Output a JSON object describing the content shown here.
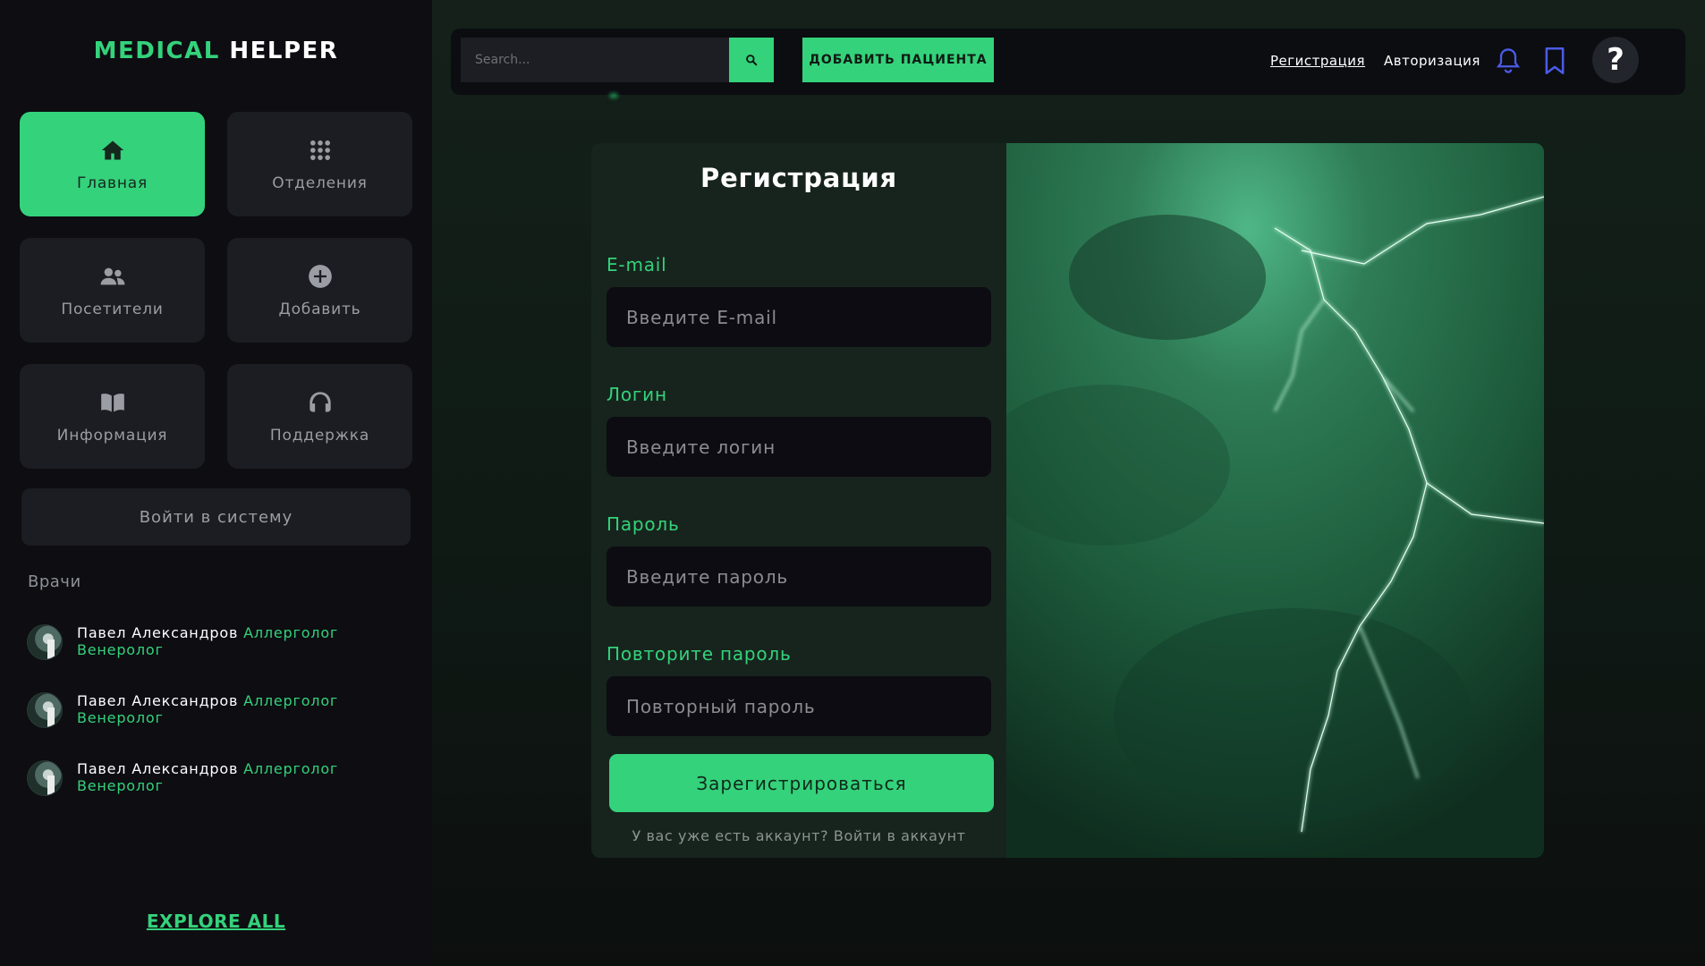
{
  "sidebar": {
    "logo": {
      "part1": "MEDICAL",
      "part2": "HELPER"
    },
    "tiles": [
      {
        "label": "Главная",
        "icon": "home-icon",
        "active": true
      },
      {
        "label": "Отделения",
        "icon": "grid-icon",
        "active": false
      },
      {
        "label": "Посетители",
        "icon": "users-icon",
        "active": false
      },
      {
        "label": "Добавить",
        "icon": "plus-circle-icon",
        "active": false
      },
      {
        "label": "Информация",
        "icon": "book-icon",
        "active": false
      },
      {
        "label": "Поддержка",
        "icon": "headphones-icon",
        "active": false
      }
    ],
    "login_button": "Войти в систему",
    "doctors_title": "Врачи",
    "doctors": [
      {
        "name": "Павел Александров",
        "spec1": "Аллерголог",
        "spec2": "Венеролог"
      },
      {
        "name": "Павел Александров",
        "spec1": "Аллерголог",
        "spec2": "Венеролог"
      },
      {
        "name": "Павел Александров",
        "spec1": "Аллерголог",
        "spec2": "Венеролог"
      }
    ],
    "explore_all": "EXPLORE ALL"
  },
  "topbar": {
    "search_placeholder": "Search...",
    "add_patient": "ДОБАВИТЬ ПАЦИЕНТА",
    "nav": {
      "register": "Регистрация",
      "login": "Авторизация"
    },
    "help": "?"
  },
  "form": {
    "title": "Регистрация",
    "fields": [
      {
        "label": "E-mail",
        "placeholder": "Введите E-mail"
      },
      {
        "label": "Логин",
        "placeholder": "Введите логин"
      },
      {
        "label": "Пароль",
        "placeholder": "Введите пароль"
      },
      {
        "label": "Повторите пароль",
        "placeholder": "Повторный пароль"
      }
    ],
    "submit": "Зарегистрироваться",
    "have_account": "У вас уже есть аккаунт?",
    "login_link": "Войти в аккаунт"
  },
  "colors": {
    "accent": "#34d27b",
    "sidebar_bg": "#0d0d12",
    "tile_bg": "#1b1d22",
    "icon_blue": "#4b5be6"
  }
}
